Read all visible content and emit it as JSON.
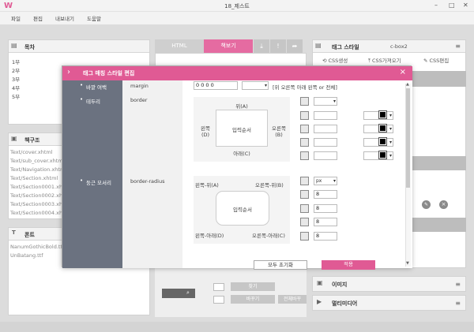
{
  "window": {
    "logo": "W",
    "title": "18_제스트",
    "controls": [
      "–",
      "□",
      "✕"
    ]
  },
  "menu": [
    "파일",
    "편집",
    "내보내기",
    "도움말"
  ],
  "toc": {
    "title": "목차",
    "items": [
      "1부",
      "2부",
      "3부",
      "4부",
      "5부"
    ]
  },
  "files": {
    "title": "책구조",
    "items": [
      "Text/cover.xhtml",
      "Text/sub_cover.xhtml",
      "Text/Navigation.xhtml",
      "Text/Section.xhtml",
      "Text/Section0001.xhtml",
      "Text/Section0002.xhtml",
      "Text/Section0003.xhtml",
      "Text/Section0004.xhtml"
    ]
  },
  "fonts": {
    "title": "폰트",
    "items": [
      "NanumGothicBold.ttf",
      "UnBatang.ttf"
    ]
  },
  "editor": {
    "tab_html": "HTML",
    "tab_view": "책보기"
  },
  "tagstyle": {
    "title": "태그 스타일",
    "selector": "c-box2",
    "btn_make": "CSS생성",
    "btn_import": "CSS가져오기",
    "btn_edit": "CSS편집"
  },
  "image_panel": {
    "title": "이미지"
  },
  "media_panel": {
    "title": "멀티미디어"
  },
  "bottom": {
    "find": "찾기",
    "replace": "바꾸기",
    "replace_all": "전체바꾸"
  },
  "dialog": {
    "title": "태그 매칭 스타일 편집",
    "close": "×",
    "rows": [
      {
        "label": "바깥 여백",
        "prop": "margin"
      },
      {
        "label": "테두리",
        "prop": "border"
      },
      {
        "label": "둥근 모서리",
        "prop": "border-radius"
      }
    ],
    "margin_value": "0 0 0 0",
    "margin_hint": "[위 오른쪽 아래 왼쪽 or 전체]",
    "border_box": {
      "top": "위(A)",
      "left": "왼쪽\n(D)",
      "right": "오른쪽\n(B)",
      "bottom": "아래(C)",
      "center": "입력순서"
    },
    "radius_box": {
      "tl": "왼쪽-위(A)",
      "tr": "오른쪽-위(B)",
      "bl": "왼쪽-아래(D)",
      "br": "오른쪽-아래(C)",
      "center": "입력순서"
    },
    "radius_unit": "px",
    "radius_values": [
      "8",
      "8",
      "8",
      "8"
    ],
    "btn_reset": "모두 초기화",
    "btn_ok": "적용"
  }
}
